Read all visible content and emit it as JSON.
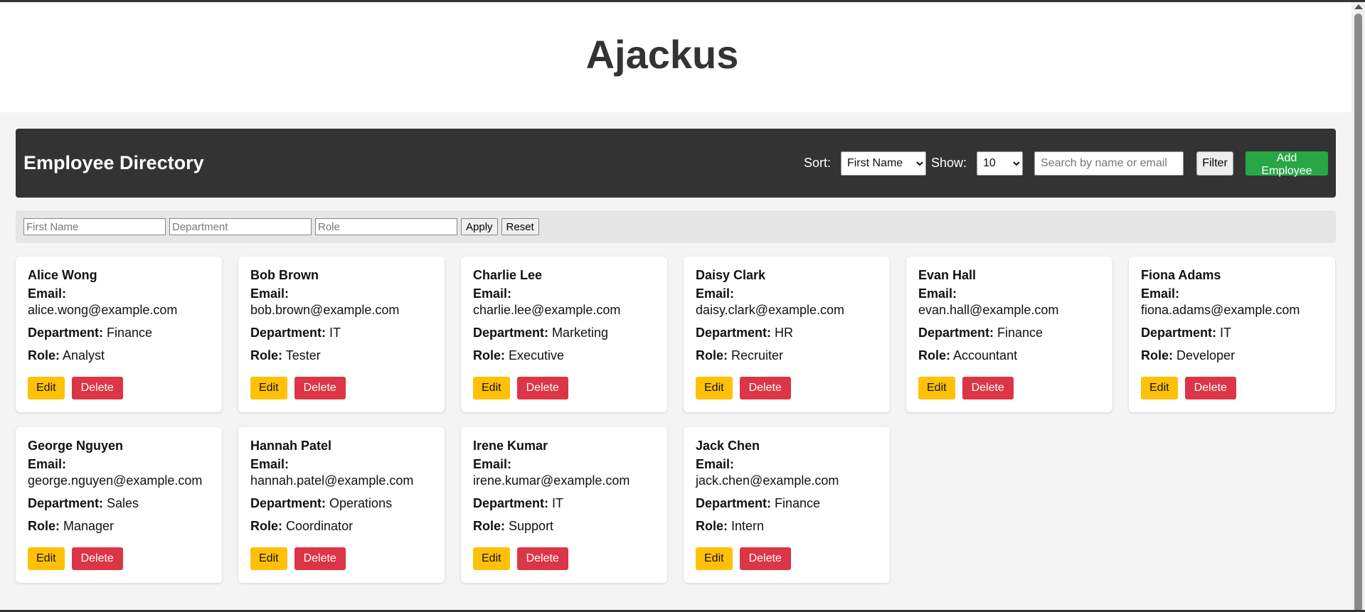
{
  "app_title": "Ajackus",
  "toolbar": {
    "heading": "Employee Directory",
    "sort_label": "Sort:",
    "sort_selected": "First Name",
    "show_label": "Show:",
    "show_selected": "10",
    "search_placeholder": "Search by name or email",
    "filter_label": "Filter",
    "add_label": "Add Employee"
  },
  "filter_panel": {
    "first_name_placeholder": "First Name",
    "department_placeholder": "Department",
    "role_placeholder": "Role",
    "apply_label": "Apply",
    "reset_label": "Reset"
  },
  "labels": {
    "email": "Email:",
    "department": "Department:",
    "role": "Role:",
    "edit": "Edit",
    "delete": "Delete"
  },
  "employees": [
    {
      "name": "Alice Wong",
      "email": "alice.wong@example.com",
      "department": "Finance",
      "role": "Analyst"
    },
    {
      "name": "Bob Brown",
      "email": "bob.brown@example.com",
      "department": "IT",
      "role": "Tester"
    },
    {
      "name": "Charlie Lee",
      "email": "charlie.lee@example.com",
      "department": "Marketing",
      "role": "Executive"
    },
    {
      "name": "Daisy Clark",
      "email": "daisy.clark@example.com",
      "department": "HR",
      "role": "Recruiter"
    },
    {
      "name": "Evan Hall",
      "email": "evan.hall@example.com",
      "department": "Finance",
      "role": "Accountant"
    },
    {
      "name": "Fiona Adams",
      "email": "fiona.adams@example.com",
      "department": "IT",
      "role": "Developer"
    },
    {
      "name": "George Nguyen",
      "email": "george.nguyen@example.com",
      "department": "Sales",
      "role": "Manager"
    },
    {
      "name": "Hannah Patel",
      "email": "hannah.patel@example.com",
      "department": "Operations",
      "role": "Coordinator"
    },
    {
      "name": "Irene Kumar",
      "email": "irene.kumar@example.com",
      "department": "IT",
      "role": "Support"
    },
    {
      "name": "Jack Chen",
      "email": "jack.chen@example.com",
      "department": "Finance",
      "role": "Intern"
    }
  ],
  "colors": {
    "header_bar": "#333333",
    "add_button": "#28a745",
    "edit_button": "#ffc107",
    "delete_button": "#dc3545"
  }
}
